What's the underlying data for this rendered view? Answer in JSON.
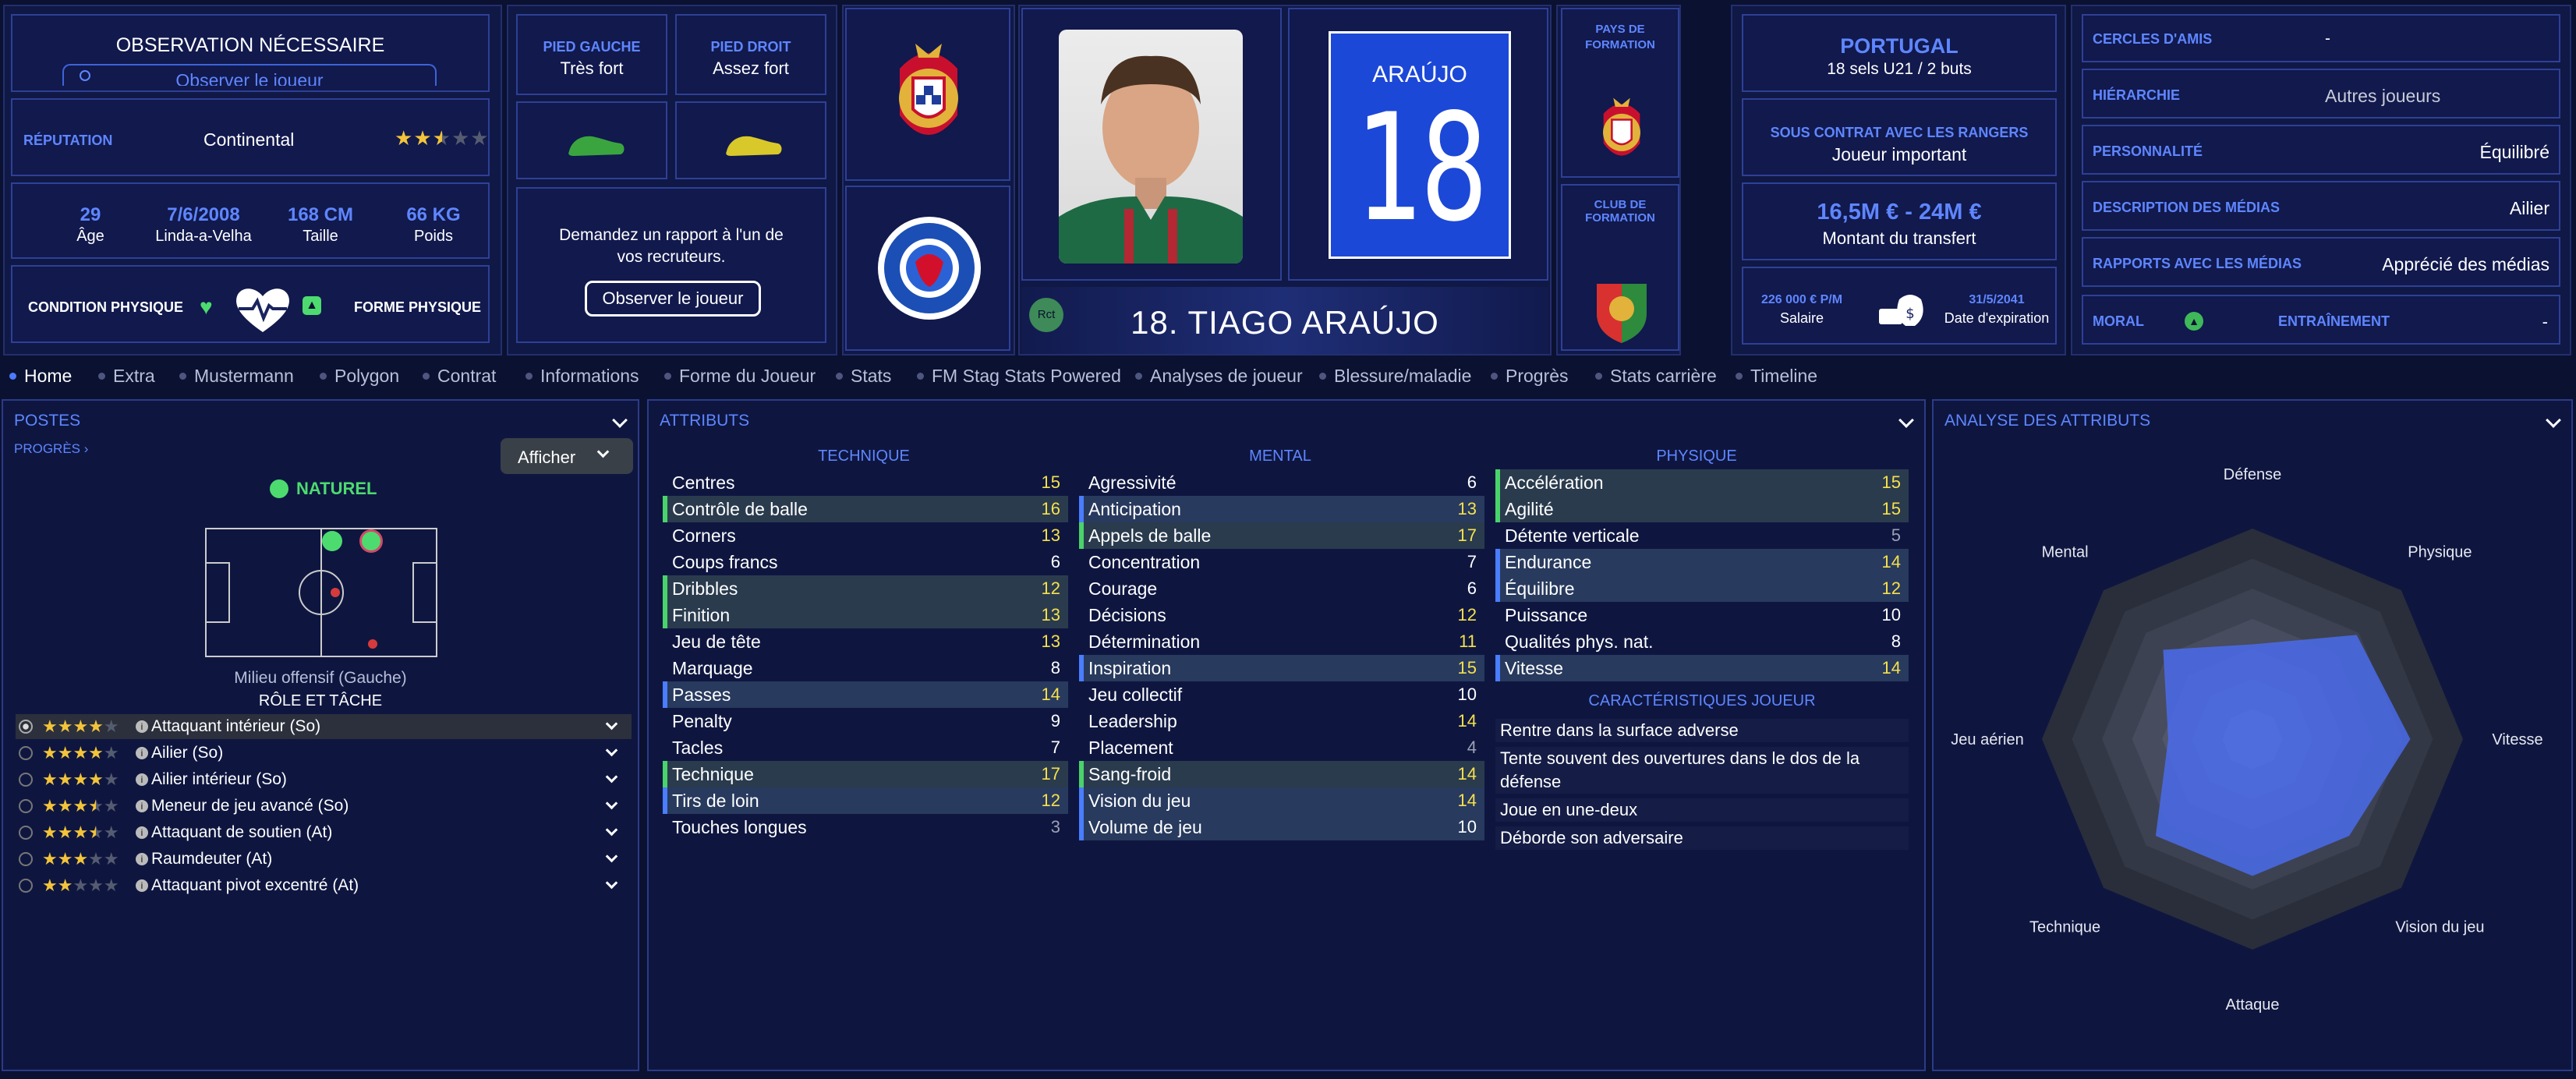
{
  "scout": {
    "title": "OBSERVATION NÉCESSAIRE",
    "field": "Observer le joueur"
  },
  "reputation": {
    "label": "RÉPUTATION",
    "value": "Continental",
    "stars": 2.5
  },
  "bio": [
    {
      "value": "29",
      "label": "Âge"
    },
    {
      "value": "7/6/2008",
      "label": "Linda-a-Velha"
    },
    {
      "value": "168 CM",
      "label": "Taille"
    },
    {
      "value": "66 KG",
      "label": "Poids"
    }
  ],
  "condition": {
    "label": "CONDITION PHYSIQUE",
    "form_label": "FORME PHYSIQUE"
  },
  "feet": {
    "left_label": "PIED GAUCHE",
    "left_value": "Très fort",
    "right_label": "PIED DROIT",
    "right_value": "Assez fort"
  },
  "report": {
    "text": "Demandez un rapport à l'un de vos recruteurs.",
    "button": "Observer le joueur"
  },
  "shirt": {
    "name": "ARAÚJO",
    "number": "18"
  },
  "player": {
    "title": "18. TIAGO ARAÚJO",
    "badge": "Rct"
  },
  "nation": {
    "label": "PAYS DE FORMATION",
    "club_label": "CLUB DE FORMATION"
  },
  "international": {
    "country": "PORTUGAL",
    "caps": "18 sels U21 / 2 buts"
  },
  "contract": {
    "label": "SOUS CONTRAT AVEC LES RANGERS",
    "value": "Joueur important"
  },
  "transfer": {
    "value": "16,5M € - 24M €",
    "label": "Montant du transfert"
  },
  "wage": {
    "value": "226 000 € P/M",
    "label": "Salaire",
    "expiry": "31/5/2041",
    "expiry_label": "Date d'expiration"
  },
  "personal": [
    {
      "label": "CERCLES D'AMIS",
      "value": "-"
    },
    {
      "label": "HIÉRARCHIE",
      "value": "Autres joueurs"
    },
    {
      "label": "PERSONNALITÉ",
      "value": "Équilibré"
    },
    {
      "label": "DESCRIPTION DES MÉDIAS",
      "value": "Ailier"
    },
    {
      "label": "RAPPORTS AVEC LES MÉDIAS",
      "value": "Apprécié des médias"
    }
  ],
  "morale": {
    "label": "MORAL",
    "training_label": "ENTRAÎNEMENT",
    "training_value": "-"
  },
  "tabs": [
    "Home",
    "Extra",
    "Mustermann",
    "Polygon",
    "Contrat",
    "Informations",
    "Forme du Joueur",
    "Stats",
    "FM Stag Stats Powered",
    "Analyses de joueur",
    "Blessure/maladie",
    "Progrès",
    "Stats carrière",
    "Timeline"
  ],
  "positions": {
    "title": "POSTES",
    "progress": "PROGRÈS",
    "show": "Afficher",
    "natural": "NATUREL",
    "position_name": "Milieu offensif (Gauche)",
    "role_title": "RÔLE ET TÂCHE",
    "roles": [
      {
        "name": "Attaquant intérieur (So)",
        "stars": 4
      },
      {
        "name": "Ailier (So)",
        "stars": 4
      },
      {
        "name": "Ailier intérieur (So)",
        "stars": 4
      },
      {
        "name": "Meneur de jeu avancé (So)",
        "stars": 3.5
      },
      {
        "name": "Attaquant de soutien (At)",
        "stars": 3.5
      },
      {
        "name": "Raumdeuter (At)",
        "stars": 3
      },
      {
        "name": "Attaquant pivot excentré (At)",
        "stars": 2
      }
    ]
  },
  "attributes": {
    "title": "ATTRIBUTS",
    "technical_title": "TECHNIQUE",
    "mental_title": "MENTAL",
    "physical_title": "PHYSIQUE",
    "technical": [
      {
        "name": "Centres",
        "value": "15"
      },
      {
        "name": "Contrôle de balle",
        "value": "16"
      },
      {
        "name": "Corners",
        "value": "13"
      },
      {
        "name": "Coups francs",
        "value": "6"
      },
      {
        "name": "Dribbles",
        "value": "12"
      },
      {
        "name": "Finition",
        "value": "13"
      },
      {
        "name": "Jeu de tête",
        "value": "13"
      },
      {
        "name": "Marquage",
        "value": "8"
      },
      {
        "name": "Passes",
        "value": "14"
      },
      {
        "name": "Penalty",
        "value": "9"
      },
      {
        "name": "Tacles",
        "value": "7"
      },
      {
        "name": "Technique",
        "value": "17"
      },
      {
        "name": "Tirs de loin",
        "value": "12"
      },
      {
        "name": "Touches longues",
        "value": "3"
      }
    ],
    "mental": [
      {
        "name": "Agressivité",
        "value": "6"
      },
      {
        "name": "Anticipation",
        "value": "13"
      },
      {
        "name": "Appels de balle",
        "value": "17"
      },
      {
        "name": "Concentration",
        "value": "7"
      },
      {
        "name": "Courage",
        "value": "6"
      },
      {
        "name": "Décisions",
        "value": "12"
      },
      {
        "name": "Détermination",
        "value": "11"
      },
      {
        "name": "Inspiration",
        "value": "15"
      },
      {
        "name": "Jeu collectif",
        "value": "10"
      },
      {
        "name": "Leadership",
        "value": "14"
      },
      {
        "name": "Placement",
        "value": "4"
      },
      {
        "name": "Sang-froid",
        "value": "14"
      },
      {
        "name": "Vision du jeu",
        "value": "14"
      },
      {
        "name": "Volume de jeu",
        "value": "10"
      }
    ],
    "physical": [
      {
        "name": "Accélération",
        "value": "15"
      },
      {
        "name": "Agilité",
        "value": "15"
      },
      {
        "name": "Détente verticale",
        "value": "5"
      },
      {
        "name": "Endurance",
        "value": "14"
      },
      {
        "name": "Équilibre",
        "value": "12"
      },
      {
        "name": "Puissance",
        "value": "10"
      },
      {
        "name": "Qualités phys. nat.",
        "value": "8"
      },
      {
        "name": "Vitesse",
        "value": "14"
      }
    ],
    "traits_title": "CARACTÉRISTIQUES JOUEUR",
    "traits": [
      "Rentre dans la surface adverse",
      "Tente souvent des ouvertures dans le dos de la défense",
      "Joue en une-deux",
      "Déborde son adversaire"
    ]
  },
  "analysis": {
    "title": "ANALYSE DES ATTRIBUTS"
  },
  "chart_data": {
    "type": "radar",
    "title": "ANALYSE DES ATTRIBUTS",
    "axes": [
      "Défense",
      "Physique",
      "Vitesse",
      "Vision du jeu",
      "Attaque",
      "Technique",
      "Jeu aérien",
      "Mental"
    ],
    "values": [
      9,
      14,
      15,
      13,
      13,
      13,
      8,
      12
    ],
    "range": [
      0,
      20
    ],
    "series_color": "#4a6cf0"
  }
}
